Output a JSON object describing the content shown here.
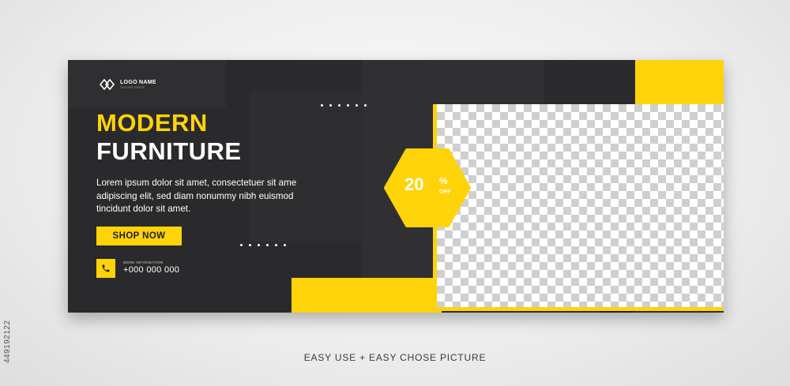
{
  "logo": {
    "name": "LOGO NAME",
    "tagline": "TAGLINE SPACE"
  },
  "headline": {
    "line1": "MODERN",
    "line2": "FURNITURE"
  },
  "body": {
    "lines": [
      "Lorem ipsum dolor sit amet, consectetuer sit ame",
      "adipiscing elit, sed diam nonummy nibh euismod",
      "tincidunt dolor sit amet."
    ]
  },
  "cta": {
    "label": "SHOP NOW"
  },
  "contact": {
    "label": "MORE INFORMATION",
    "phone": "+000 000 000",
    "icon": "phone-icon"
  },
  "discount": {
    "value": "20",
    "percent": "%",
    "off": "OFF"
  },
  "caption": "EASY USE + EASY CHOSE PICTURE",
  "side_id": "449192122",
  "colors": {
    "accent": "#ffd30a",
    "dark": "#2b2b2d",
    "text": "#ffffff"
  }
}
